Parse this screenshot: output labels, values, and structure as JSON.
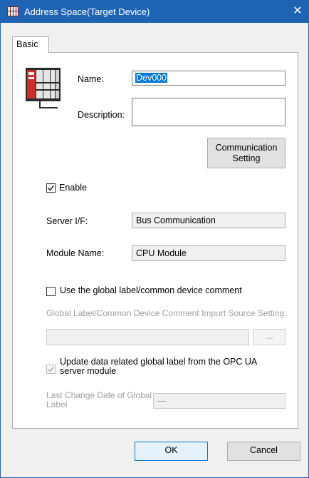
{
  "window": {
    "title": "Address Space(Target Device)",
    "close_glyph": "✕",
    "accent": "#1f63b3"
  },
  "tabs": [
    {
      "label": "Basic",
      "active": true
    }
  ],
  "device": {
    "icon": "plc-device-icon",
    "name_label": "Name:",
    "name_value": "Dev000",
    "description_label": "Description:",
    "description_value": ""
  },
  "buttons": {
    "communication_setting_line1": "Communication",
    "communication_setting_line2": "Setting",
    "browse": "...",
    "ok": "OK",
    "cancel": "Cancel"
  },
  "enable": {
    "label": "Enable",
    "checked": true
  },
  "server_if": {
    "label": "Server I/F:",
    "value": "Bus Communication"
  },
  "module_name": {
    "label": "Module Name:",
    "value": "CPU Module"
  },
  "global_label": {
    "checkbox_label": "Use the global label/common device comment",
    "checked": false,
    "import_source_label": "Global Label/Common Device Comment Import Source Setting:",
    "import_source_value": "",
    "update_label_line1": "Update data related global label from the OPC UA",
    "update_label_line2": "server module",
    "update_checked": true,
    "last_change_label_line1": "Last Change Date of Global",
    "last_change_label_line2": "Label",
    "last_change_value": "—"
  }
}
